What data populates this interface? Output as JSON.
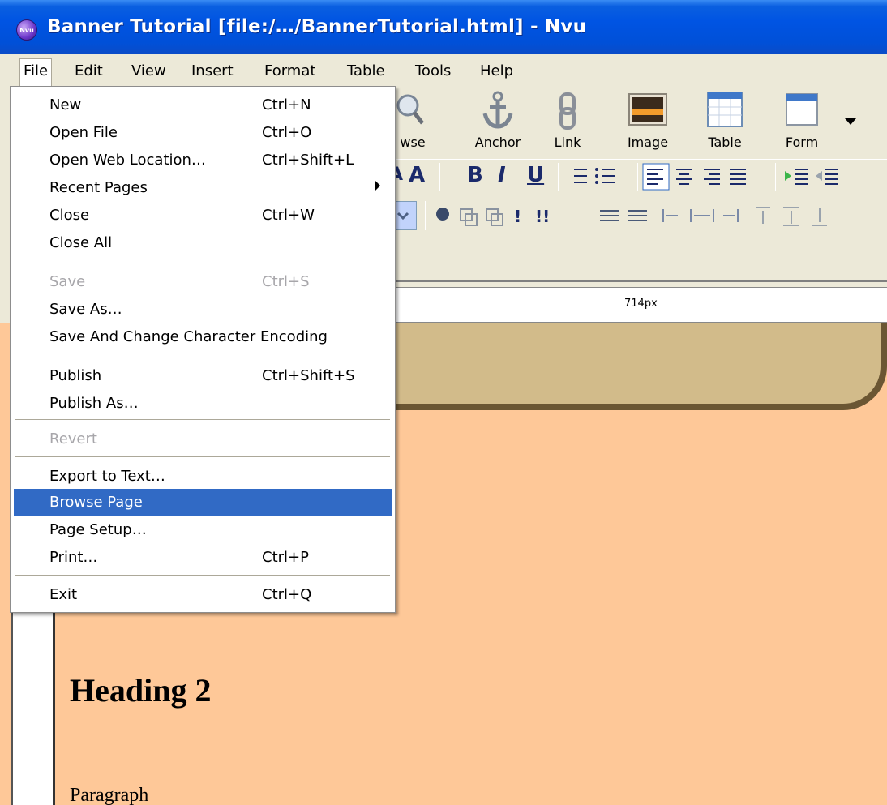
{
  "window": {
    "title": "Banner Tutorial [file:/…/BannerTutorial.html] - Nvu",
    "icon_text": "Nvu"
  },
  "menubar": {
    "items": [
      {
        "label": "File"
      },
      {
        "label": "Edit"
      },
      {
        "label": "View"
      },
      {
        "label": "Insert"
      },
      {
        "label": "Format"
      },
      {
        "label": "Table"
      },
      {
        "label": "Tools"
      },
      {
        "label": "Help"
      }
    ]
  },
  "toolbar": {
    "browse_label": "wse",
    "anchor_label": "Anchor",
    "link_label": "Link",
    "image_label": "Image",
    "table_label": "Table",
    "form_label": "Form"
  },
  "format_toolbar": {
    "bold": "B",
    "italic": "I",
    "underline": "U",
    "font_small": "A",
    "font_large": "A"
  },
  "ruler": {
    "label": "714px"
  },
  "file_menu": {
    "items": [
      {
        "label": "New",
        "shortcut": "Ctrl+N"
      },
      {
        "label": "Open File",
        "shortcut": "Ctrl+O"
      },
      {
        "label": "Open Web Location…",
        "shortcut": "Ctrl+Shift+L"
      },
      {
        "label": "Recent Pages",
        "shortcut": ""
      },
      {
        "label": "Close",
        "shortcut": "Ctrl+W"
      },
      {
        "label": "Close All",
        "shortcut": ""
      },
      {
        "label": "Save",
        "shortcut": "Ctrl+S"
      },
      {
        "label": "Save As…",
        "shortcut": ""
      },
      {
        "label": "Save And Change Character Encoding",
        "shortcut": ""
      },
      {
        "label": "Publish",
        "shortcut": "Ctrl+Shift+S"
      },
      {
        "label": "Publish As…",
        "shortcut": ""
      },
      {
        "label": "Revert",
        "shortcut": ""
      },
      {
        "label": "Export to Text…",
        "shortcut": ""
      },
      {
        "label": "Browse Page",
        "shortcut": ""
      },
      {
        "label": "Page Setup…",
        "shortcut": ""
      },
      {
        "label": "Print…",
        "shortcut": "Ctrl+P"
      },
      {
        "label": "Exit",
        "shortcut": "Ctrl+Q"
      }
    ]
  },
  "document": {
    "heading": "Heading 2",
    "paragraph": "Paragraph"
  },
  "colors": {
    "titlebar": "#0054e3",
    "highlight": "#316ac5",
    "page_background": "#fec898",
    "banner": "#d2bb8a",
    "banner_border": "#6b5633"
  }
}
